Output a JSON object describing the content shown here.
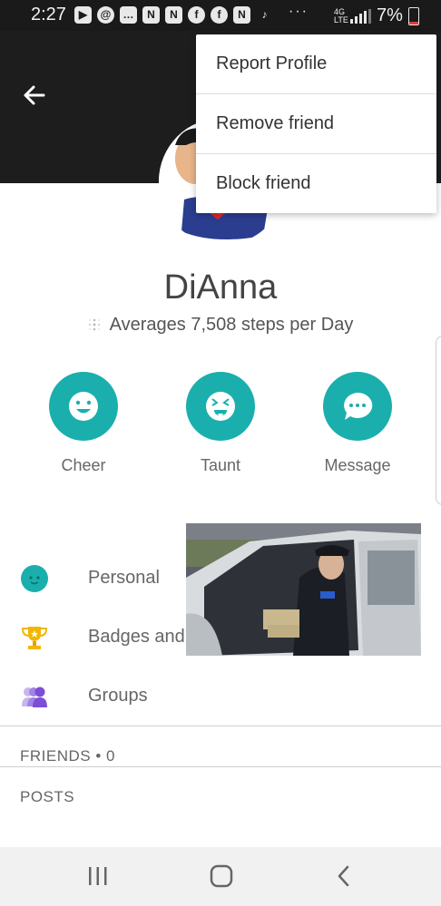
{
  "status_bar": {
    "time": "2:27",
    "network": "4G LTE",
    "battery": "7%",
    "icons": [
      "youtube-icon",
      "threads-icon",
      "message-icon",
      "app-n-icon",
      "app-n-icon",
      "facebook-icon",
      "facebook-icon",
      "app-n-icon",
      "tiktok-icon"
    ]
  },
  "header": {
    "background": "#1d1d1d"
  },
  "menu": {
    "items": [
      {
        "label": "Report Profile"
      },
      {
        "label": "Remove friend"
      },
      {
        "label": "Block friend"
      }
    ]
  },
  "profile": {
    "name": "DiAnna",
    "steps_text": "Averages 7,508 steps per Day"
  },
  "actions": [
    {
      "label": "Cheer",
      "icon": "smile-icon"
    },
    {
      "label": "Taunt",
      "icon": "taunt-face-icon"
    },
    {
      "label": "Message",
      "icon": "chat-bubble-icon"
    }
  ],
  "rows": [
    {
      "label": "Personal",
      "icon": "personal-icon"
    },
    {
      "label": "Badges and",
      "icon": "trophy-icon"
    },
    {
      "label": "Groups",
      "icon": "groups-icon"
    }
  ],
  "sections": {
    "friends": "FRIENDS • 0",
    "posts": "POSTS"
  },
  "colors": {
    "accent": "#1aafad",
    "trophy": "#f2b705",
    "groups": "#7b4fd6",
    "header_bg": "#1d1d1d"
  }
}
